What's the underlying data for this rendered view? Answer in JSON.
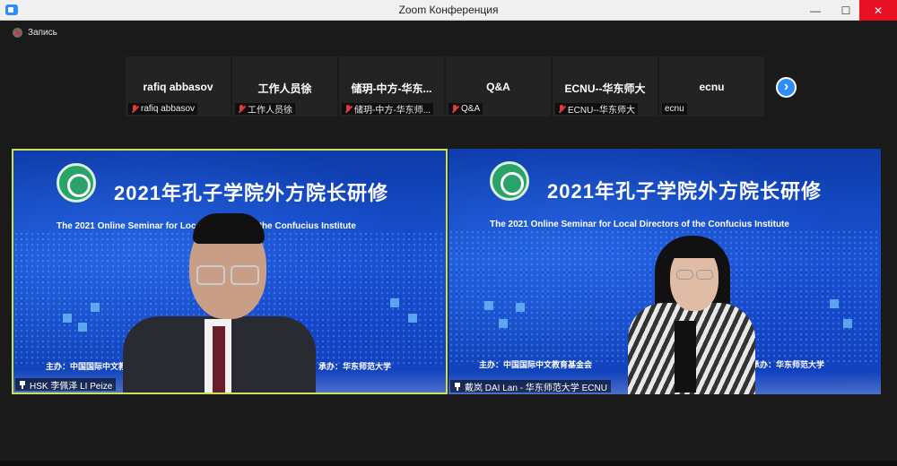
{
  "window": {
    "title": "Zoom Конференция"
  },
  "recording": {
    "label": "Запись"
  },
  "participants": [
    {
      "name": "rafiq abbasov",
      "label": "rafiq abbasov"
    },
    {
      "name": "工作人员徐",
      "label": "工作人员徐"
    },
    {
      "name": "储玥-中方-华东...",
      "label": "储玥-中方-华东师..."
    },
    {
      "name": "Q&A",
      "label": "Q&A"
    },
    {
      "name": "ECNU--华东师大",
      "label": "ECNU--华东师大"
    },
    {
      "name": "ecnu",
      "label": "ecnu"
    }
  ],
  "videos": [
    {
      "title": "2021年孔子学院外方院长研修",
      "subtitle": "The 2021 Online Seminar for Local Directors of the Confucius Institute",
      "host_left": "主办：中国国际中文教育基金会",
      "host_right": "承办：华东师范大学",
      "name_label": "HSK 李佩泽 LI Peize"
    },
    {
      "title": "2021年孔子学院外方院长研修",
      "subtitle": "The 2021 Online Seminar for Local Directors of the Confucius Institute",
      "host_left": "主办：中国国际中文教育基金会",
      "host_right": "承办：华东师范大学",
      "name_label": "戴岚 DAI Lan - 华东师范大学 ECNU"
    }
  ],
  "colors": {
    "accent": "#2d8cff",
    "active_speaker_border": "#c8e05a",
    "close": "#e81123"
  }
}
